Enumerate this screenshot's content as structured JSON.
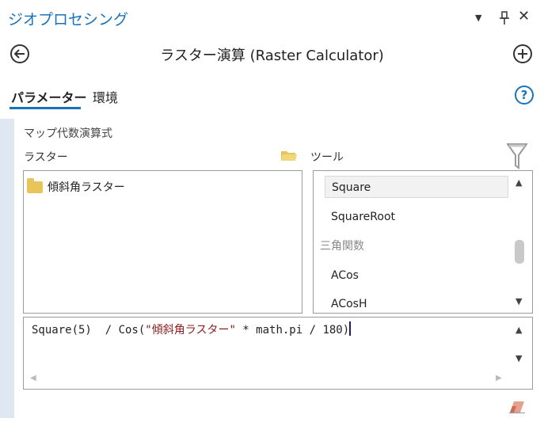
{
  "pane": {
    "title": "ジオプロセシング",
    "controls": {
      "menu_glyph": "▼",
      "pin_glyph": "📌",
      "close_glyph": "✕"
    }
  },
  "tool": {
    "title": "ラスター演算 (Raster Calculator)",
    "back_icon": "back-arrow-icon",
    "add_icon": "plus-icon"
  },
  "tabs": [
    {
      "label": "パラメーター",
      "active": true
    },
    {
      "label": "環境",
      "active": false
    }
  ],
  "help_glyph": "?",
  "expression_section": {
    "label": "マップ代数演算式",
    "rasters_label": "ラスター",
    "tools_label": "ツール",
    "rasters": [
      "傾斜角ラスター"
    ],
    "tools": [
      {
        "label": "Square",
        "type": "item",
        "selected": true
      },
      {
        "label": "SquareRoot",
        "type": "item",
        "selected": false
      },
      {
        "label": "三角関数",
        "type": "category",
        "selected": false
      },
      {
        "label": "ACos",
        "type": "item",
        "selected": false
      },
      {
        "label": "ACosH",
        "type": "item",
        "selected": false
      }
    ],
    "expression": {
      "part1": "Square(5)  / Cos(",
      "string_literal": "\"傾斜角ラスター\"",
      "part2": " * math.pi / 180)"
    }
  },
  "colors": {
    "accent": "#1a73b8",
    "folder": "#e8c55a",
    "string": "#8a1c1c",
    "side_strip": "#dfe7f2"
  }
}
